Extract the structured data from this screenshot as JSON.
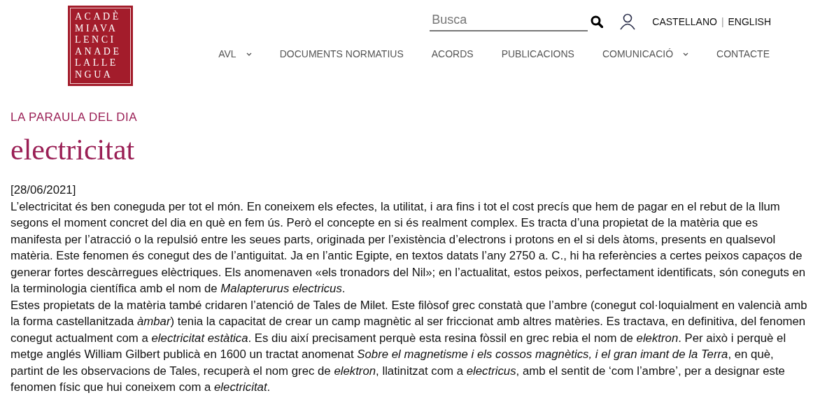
{
  "logo": {
    "lines": [
      "ACADÈ",
      "MIAVA",
      "LENCI",
      "ANADE",
      "LALLE",
      "NGUA"
    ]
  },
  "search": {
    "placeholder": "Busca"
  },
  "languages": [
    {
      "label": "CASTELLANO"
    },
    {
      "label": "ENGLISH"
    }
  ],
  "language_separator": "|",
  "nav": [
    {
      "label": "AVL",
      "has_submenu": true
    },
    {
      "label": "DOCUMENTS NORMATIUS",
      "has_submenu": false
    },
    {
      "label": "ACORDS",
      "has_submenu": false
    },
    {
      "label": "PUBLICACIONS",
      "has_submenu": false
    },
    {
      "label": "COMUNICACIÓ",
      "has_submenu": true
    },
    {
      "label": "CONTACTE",
      "has_submenu": false
    }
  ],
  "section_title": "LA PARAULA DEL DIA",
  "word": "electricitat",
  "date": "[28/06/2021]",
  "paragraphs": [
    "L’electricitat és ben coneguda per tot el món. En coneixem els efectes, la utilitat, i ara fins i tot el cost precís que hem de pagar en el rebut de la llum segons el moment concret del dia en què en fem ús. Però el concepte en si és realment complex. Es tracta d’una propietat de la matèria que es manifesta per l’atracció o la repulsió entre les seues parts, originada per l’existència d’electrons i protons en el si dels àtoms, presents en qualsevol matèria. Este fenomen és conegut des de l’antiguitat. Ja en l’antic Egipte, en textos datats l’any 2750 a. C., hi ha referències a certes peixos capaços de generar fortes descàrregues elèctriques. Els anomenaven «els tronadors del Nil»; en l’actualitat, estos peixos, perfectament identificats, són coneguts en la terminologia científica amb el nom de *Malapterurus electricus*.",
    "Estes propietats de la matèria també cridaren l’atenció de Tales de Milet. Este filòsof grec constatà que l’ambre (conegut col·loquialment en valencià amb la forma castellanitzada *àmbar*) tenia la capacitat de crear un camp magnètic al ser friccionat amb altres matèries. Es tractava, en definitiva, del fenomen conegut actualment com a *electricitat estàtica*. Es diu així precisament perquè esta resina fòssil en grec rebia el nom de *elektron*. Per això i perquè el metge anglés William Gilbert publicà en 1600 un tractat anomenat *Sobre el magnetisme i els cossos magnètics, i el gran imant de la Terra*, en què, partint de les observacions de Tales, recuperà el nom grec de *elektron*, llatinitzat com a *electricus*, amb el sentit de ‘com l’ambre’, per a designar este fenomen físic que hui coneixem com a *electricitat*."
  ]
}
